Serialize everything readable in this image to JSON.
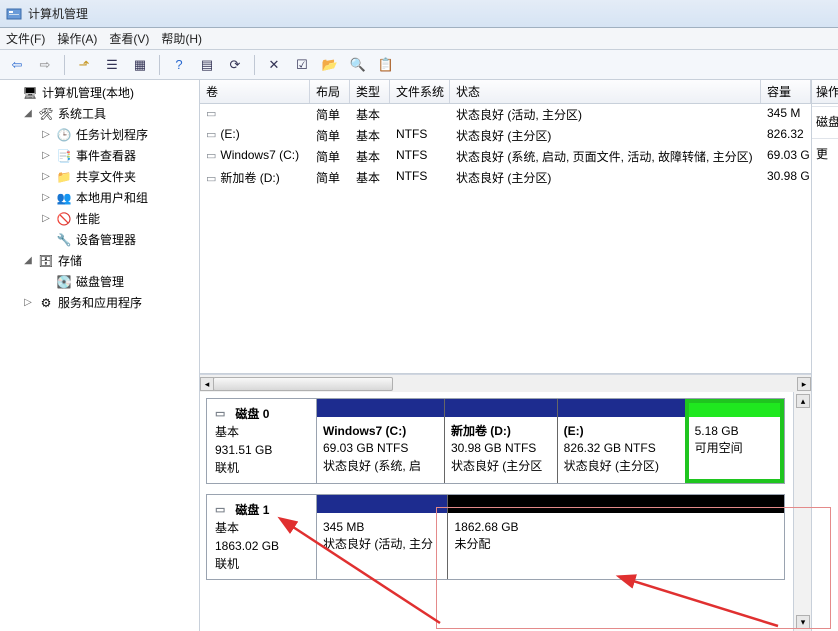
{
  "title": "计算机管理",
  "menu": {
    "file": "文件(F)",
    "action": "操作(A)",
    "view": "查看(V)",
    "help": "帮助(H)"
  },
  "tree": {
    "root": "计算机管理(本地)",
    "systools": "系统工具",
    "taskSched": "任务计划程序",
    "eventViewer": "事件查看器",
    "sharedFolders": "共享文件夹",
    "localUsers": "本地用户和组",
    "performance": "性能",
    "deviceMgr": "设备管理器",
    "storage": "存储",
    "diskMgmt": "磁盘管理",
    "services": "服务和应用程序"
  },
  "columns": {
    "volume": "卷",
    "layout": "布局",
    "type": "类型",
    "fs": "文件系统",
    "status": "状态",
    "capacity": "容量"
  },
  "volumes": [
    {
      "name": "",
      "layout": "简单",
      "type": "基本",
      "fs": "",
      "status": "状态良好 (活动, 主分区)",
      "capacity": "345 M"
    },
    {
      "name": "(E:)",
      "layout": "简单",
      "type": "基本",
      "fs": "NTFS",
      "status": "状态良好 (主分区)",
      "capacity": "826.32"
    },
    {
      "name": "Windows7 (C:)",
      "layout": "简单",
      "type": "基本",
      "fs": "NTFS",
      "status": "状态良好 (系统, 启动, 页面文件, 活动, 故障转储, 主分区)",
      "capacity": "69.03 G"
    },
    {
      "name": "新加卷 (D:)",
      "layout": "简单",
      "type": "基本",
      "fs": "NTFS",
      "status": "状态良好 (主分区)",
      "capacity": "30.98 G"
    }
  ],
  "disk0": {
    "title": "磁盘 0",
    "type": "基本",
    "size": "931.51 GB",
    "online": "联机",
    "parts": [
      {
        "name": "Windows7  (C:)",
        "size": "69.03 GB NTFS",
        "status": "状态良好 (系统, 启"
      },
      {
        "name": "新加卷  (D:)",
        "size": "30.98 GB NTFS",
        "status": "状态良好 (主分区"
      },
      {
        "name": "(E:)",
        "size": "826.32 GB NTFS",
        "status": "状态良好 (主分区)"
      },
      {
        "name": "",
        "size": "5.18 GB",
        "status": "可用空间"
      }
    ]
  },
  "disk1": {
    "title": "磁盘 1",
    "type": "基本",
    "size": "1863.02 GB",
    "online": "联机",
    "parts": [
      {
        "name": "",
        "size": "345 MB",
        "status": "状态良好 (活动, 主分"
      },
      {
        "name": "",
        "size": "1862.68 GB",
        "status": "未分配"
      }
    ]
  },
  "rightPane": {
    "header": "操作",
    "section": "磁盘管",
    "more": "更"
  }
}
